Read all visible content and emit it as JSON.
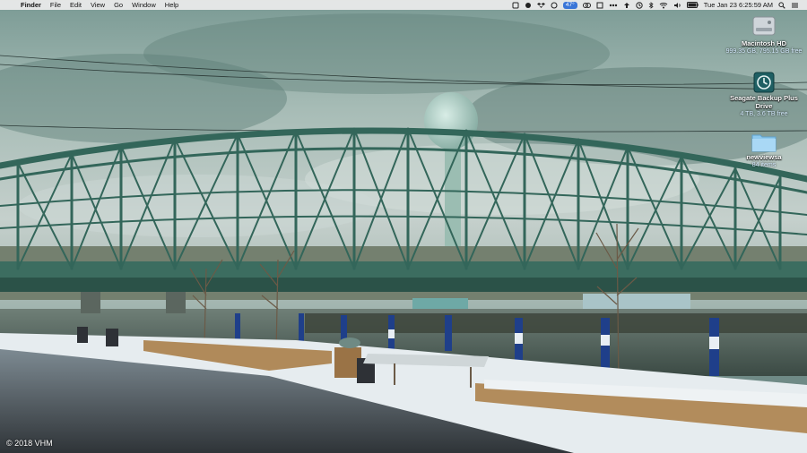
{
  "menubar": {
    "apple_glyph": "",
    "items": [
      "Finder",
      "File",
      "Edit",
      "View",
      "Go",
      "Window",
      "Help"
    ],
    "status": {
      "temperature": "47°",
      "battery": "100%",
      "clock": "Tue Jan 23  6:25:59 AM"
    }
  },
  "desktop_icons": [
    {
      "name": "Macintosh HD",
      "info": "999.35 GB, 795.15 GB free",
      "icon": "hard-drive-icon"
    },
    {
      "name": "Seagate Backup Plus Drive",
      "info": "4 TB, 3.6 TB free",
      "icon": "time-machine-drive-icon"
    },
    {
      "name": "newviewsa",
      "info": "84 items",
      "icon": "folder-icon"
    }
  ],
  "wallpaper": {
    "copyright": "© 2018 VHM",
    "colors": {
      "sky": "#8ea9a4",
      "bridge": "#3e6f63",
      "water": "#4d5f58",
      "snow": "#e9eef0"
    }
  }
}
